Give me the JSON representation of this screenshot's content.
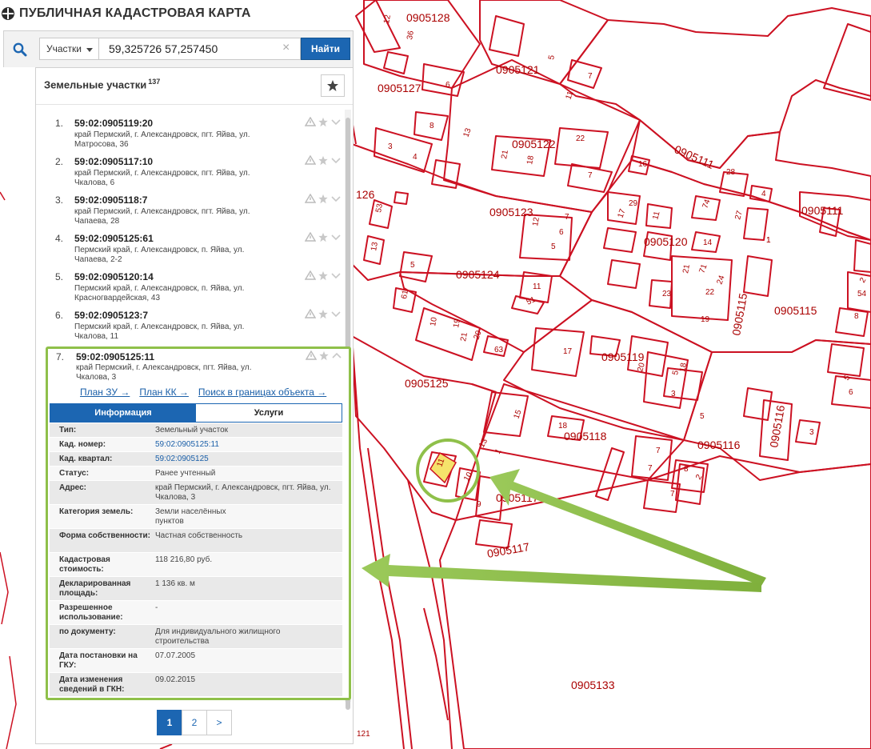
{
  "app": {
    "title": "ПУБЛИЧНАЯ КАДАСТРОВАЯ КАРТА"
  },
  "search": {
    "type_label": "Участки",
    "query": "59,325726 57,257450",
    "clear": "×",
    "find_label": "Найти"
  },
  "panel": {
    "title": "Земельные участки",
    "count": "137"
  },
  "results": [
    {
      "num": "1.",
      "cad": "59:02:0905119:20",
      "addr": "край Пермский, г. Александровск, пгт. Яйва, ул. Матросова, 36"
    },
    {
      "num": "2.",
      "cad": "59:02:0905117:10",
      "addr": "край Пермский, г. Александровск, пгт. Яйва, ул. Чкалова, 6"
    },
    {
      "num": "3.",
      "cad": "59:02:0905118:7",
      "addr": "край Пермский, г. Александровск, пгт. Яйва, ул. Чапаева, 28"
    },
    {
      "num": "4.",
      "cad": "59:02:0905125:61",
      "addr": "Пермский край, г. Александровск, п. Яйва, ул. Чапаева, 2-2"
    },
    {
      "num": "5.",
      "cad": "59:02:0905120:14",
      "addr": "Пермский край, г. Александровск, п. Яйва, ул. Красногвардейская, 43"
    },
    {
      "num": "6.",
      "cad": "59:02:0905123:7",
      "addr": "Пермский край, г. Александровск, п. Яйва, ул. Чкалова, 11"
    }
  ],
  "selected": {
    "num": "7.",
    "cad": "59:02:0905125:11",
    "addr": "край Пермский, г. Александровск, пгт. Яйва, ул. Чкалова, 3",
    "links": [
      "План ЗУ →",
      "План КК →",
      "Поиск в границах объекта →"
    ],
    "tabs": [
      "Информация",
      "Услуги"
    ],
    "props": [
      {
        "label": "Тип:",
        "value": "Земельный участок"
      },
      {
        "label": "Кад. номер:",
        "value": "59:02:0905125:11"
      },
      {
        "label": "Кад. квартал:",
        "value": "59:02:0905125"
      },
      {
        "label": "Статус:",
        "value": "Ранее учтенный"
      },
      {
        "label": "Адрес:",
        "value": "край Пермский, г. Александровск, пгт. Яйва, ул. Чкалова, 3"
      },
      {
        "label": "Категория земель:",
        "value": "Земли населённых пунктов"
      },
      {
        "label": "Форма собственности:",
        "value": "Частная собственность"
      },
      {
        "label": "Кадастровая стоимость:",
        "value": "118 216,80 руб."
      },
      {
        "label": "Декларированная площадь:",
        "value": "1 136 кв. м"
      },
      {
        "label": "Разрешенное использование:",
        "value": "-"
      },
      {
        "label": "по документу:",
        "value": "Для индивидуального жилищного строительства"
      },
      {
        "label": "Дата постановки на ГКУ:",
        "value": "07.07.2005"
      },
      {
        "label": "Дата изменения сведений в ГКН:",
        "value": "09.02.2015"
      }
    ]
  },
  "pager": {
    "pages": [
      "1",
      "2"
    ],
    "next": ">"
  },
  "map": {
    "quarters": [
      "0905128",
      "0905121",
      "0905127",
      "0905122",
      "0905111",
      "0905123",
      "0905120",
      "0905111",
      "0905124",
      "0905115",
      "0905115",
      "0905119",
      "0905125",
      "0905118",
      "0905116",
      "0905116",
      "0905117",
      "0905117",
      "0905133",
      "126"
    ],
    "parcels": [
      "12",
      "36",
      "5",
      "7",
      "11",
      "6",
      "8",
      "3",
      "4",
      "13",
      "22",
      "21",
      "18",
      "7",
      "16",
      "28",
      "4",
      "29",
      "17",
      "11",
      "74",
      "27",
      "1",
      "53",
      "12",
      "7",
      "6",
      "5",
      "14",
      "13",
      "5",
      "61",
      "11",
      "51",
      "10",
      "19",
      "21",
      "20",
      "63",
      "17",
      "20",
      "3",
      "5",
      "18",
      "21",
      "71",
      "24",
      "22",
      "23",
      "19",
      "1",
      "5",
      "7",
      "15",
      "18",
      "7",
      "8",
      "2",
      "13",
      "11",
      "10",
      "9",
      "7",
      "1",
      "3",
      "5",
      "8",
      "6",
      "54",
      "2",
      "121"
    ],
    "colors": {
      "line": "#cc1122",
      "label": "#aa0000",
      "highlight": "#f5e36b",
      "accent": "#8fc04a",
      "brand": "#1c66b2"
    }
  }
}
